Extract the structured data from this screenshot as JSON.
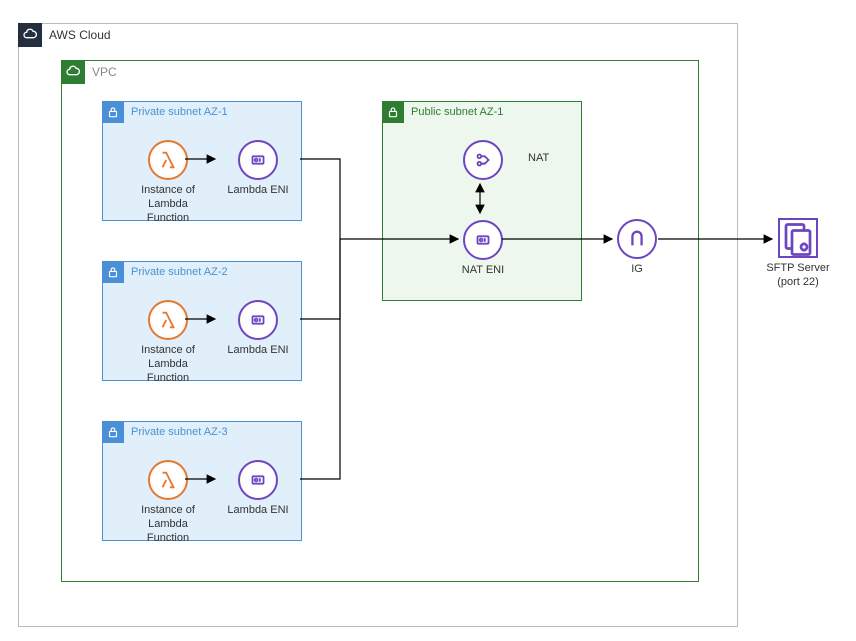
{
  "cloud": {
    "label": "AWS Cloud"
  },
  "vpc": {
    "label": "VPC"
  },
  "subnets": {
    "priv1": {
      "label": "Private subnet AZ-1"
    },
    "priv2": {
      "label": "Private subnet AZ-2"
    },
    "priv3": {
      "label": "Private subnet AZ-3"
    },
    "pub1": {
      "label": "Public subnet AZ-1"
    }
  },
  "nodes": {
    "lambda": "Instance of\nLambda Function",
    "lambda_eni": "Lambda ENI",
    "nat": "NAT",
    "nat_eni": "NAT ENI",
    "ig": "IG",
    "sftp": "SFTP Server\n(port 22)"
  }
}
